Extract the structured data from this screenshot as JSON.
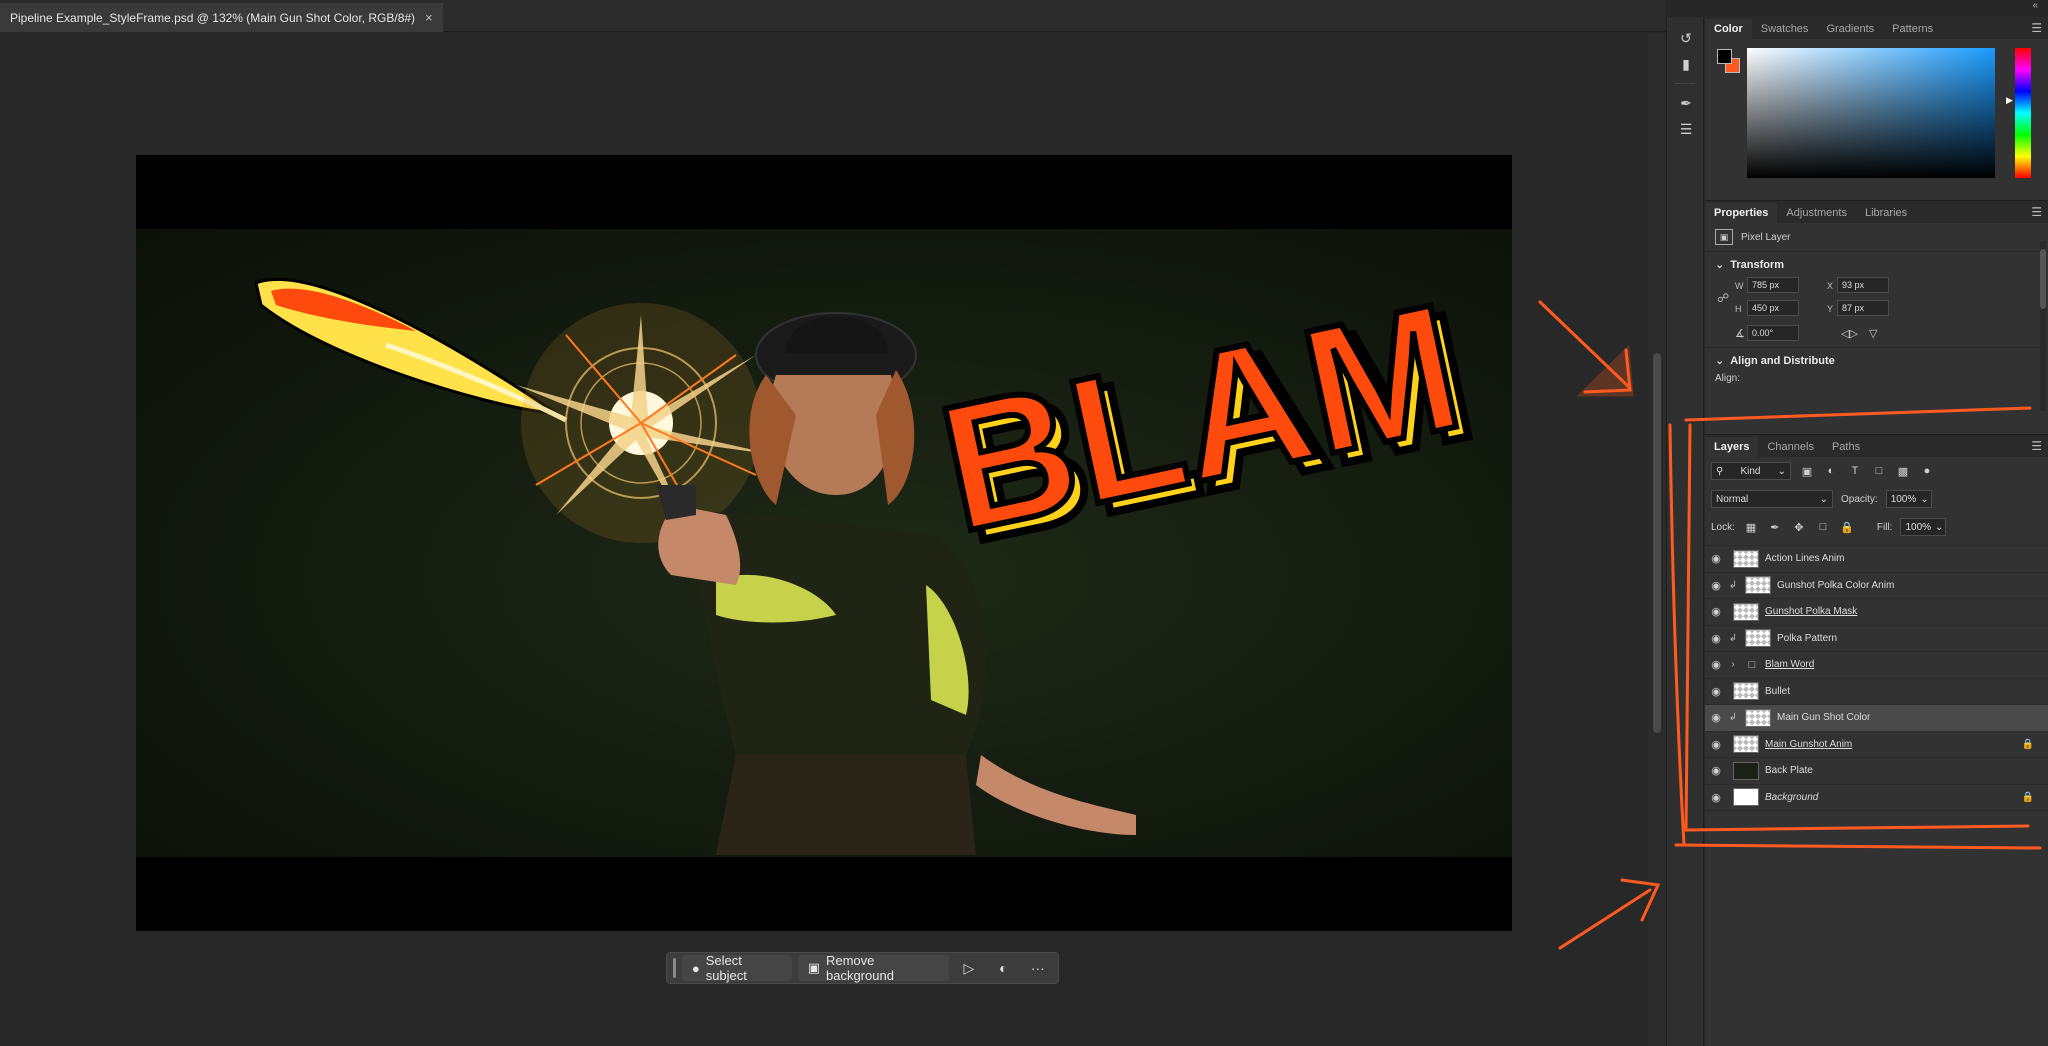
{
  "document": {
    "tab_title": "Pipeline Example_StyleFrame.psd @ 132% (Main Gun Shot Color, RGB/8#)",
    "close_glyph": "×"
  },
  "canvas": {
    "blam_text": "BLAM"
  },
  "taskbar": {
    "select_subject": "Select subject",
    "remove_background": "Remove background",
    "more": "···"
  },
  "panels": {
    "collapse": "«"
  },
  "color_panel": {
    "tabs": [
      "Color",
      "Swatches",
      "Gradients",
      "Patterns"
    ],
    "foreground": "#000000",
    "background": "#ff5a1f"
  },
  "properties_panel": {
    "tabs": [
      "Properties",
      "Adjustments",
      "Libraries"
    ],
    "layer_type": "Pixel Layer",
    "transform_label": "Transform",
    "w_label": "W",
    "w_value": "785 px",
    "x_label": "X",
    "x_value": "93 px",
    "h_label": "H",
    "h_value": "450 px",
    "y_label": "Y",
    "y_value": "87 px",
    "angle_value": "0.00°",
    "align_label": "Align and Distribute",
    "align_sub": "Align:"
  },
  "layers_panel": {
    "tabs": [
      "Layers",
      "Channels",
      "Paths"
    ],
    "filter_kind": "Kind",
    "blend_mode": "Normal",
    "opacity_label": "Opacity:",
    "opacity_value": "100%",
    "lock_label": "Lock:",
    "fill_label": "Fill:",
    "fill_value": "100%",
    "layers": [
      {
        "name": "Action Lines Anim"
      },
      {
        "name": "Gunshot Polka Color Anim"
      },
      {
        "name": "Gunshot Polka Mask"
      },
      {
        "name": "Polka Pattern"
      },
      {
        "name": "Blam Word"
      },
      {
        "name": "Bullet"
      },
      {
        "name": "Main Gun Shot Color"
      },
      {
        "name": "Main Gunshot Anim"
      },
      {
        "name": "Back Plate"
      },
      {
        "name": "Background"
      }
    ]
  },
  "colors": {
    "accent_annotation": "#ff5a1f",
    "blam_fill": "#ff4a0e",
    "blam_outline": "#ffd21a"
  }
}
